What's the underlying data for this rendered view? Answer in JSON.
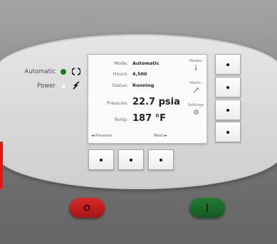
{
  "indicators": {
    "automatic_label": "Automatic",
    "power_label": "Power",
    "automatic_led_color": "#1f7a1f",
    "power_led_color": "#f3f3f3"
  },
  "screen": {
    "mode_label": "Mode:",
    "mode_value": "Automatic",
    "hours_label": "Hours:",
    "hours_value": "4,500",
    "status_label": "Status:",
    "status_value": "Running",
    "pressure_label": "Pressure:",
    "pressure_value": "22.7 psia",
    "temp_label": "Temp:",
    "temp_value": "187 °F",
    "side_1": "Modes",
    "side_2": "Maint.",
    "side_3": "Settings",
    "previous": "◄ Previous",
    "next": "Next ►"
  },
  "stop_button_symbol": "O",
  "start_button_symbol": "|",
  "colors": {
    "stop": "#c21a1a",
    "start": "#1b6b2e",
    "accent": "#e01818"
  }
}
